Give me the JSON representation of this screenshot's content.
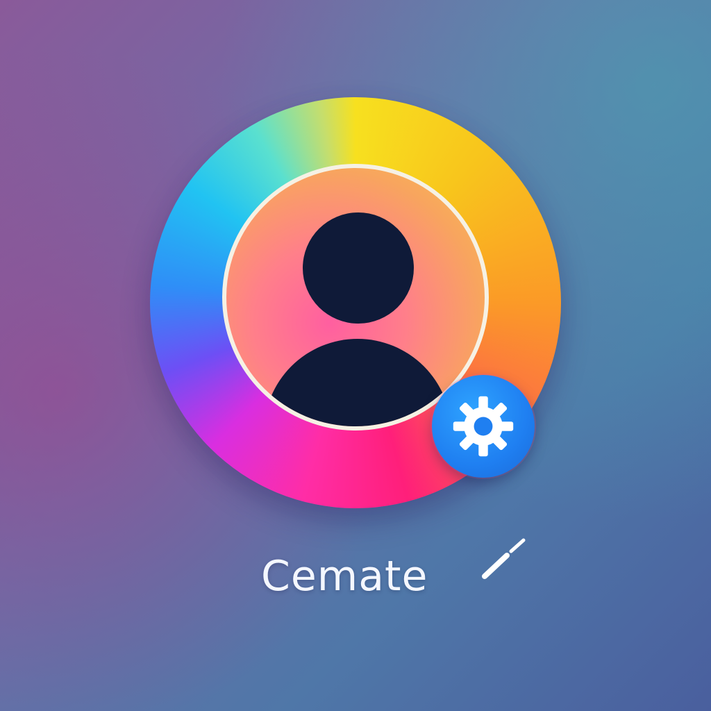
{
  "profile": {
    "label": "Cemate",
    "avatar_icon": "person-icon",
    "settings_icon": "gear-icon",
    "edit_icon": "pencil-icon"
  },
  "colors": {
    "background": "#5c6ea8",
    "avatar_silhouette": "#0f1a38",
    "inner_ring": "#f6f1e4",
    "settings_badge": "#1f7ff1",
    "label_text": "#f4f7ff"
  }
}
